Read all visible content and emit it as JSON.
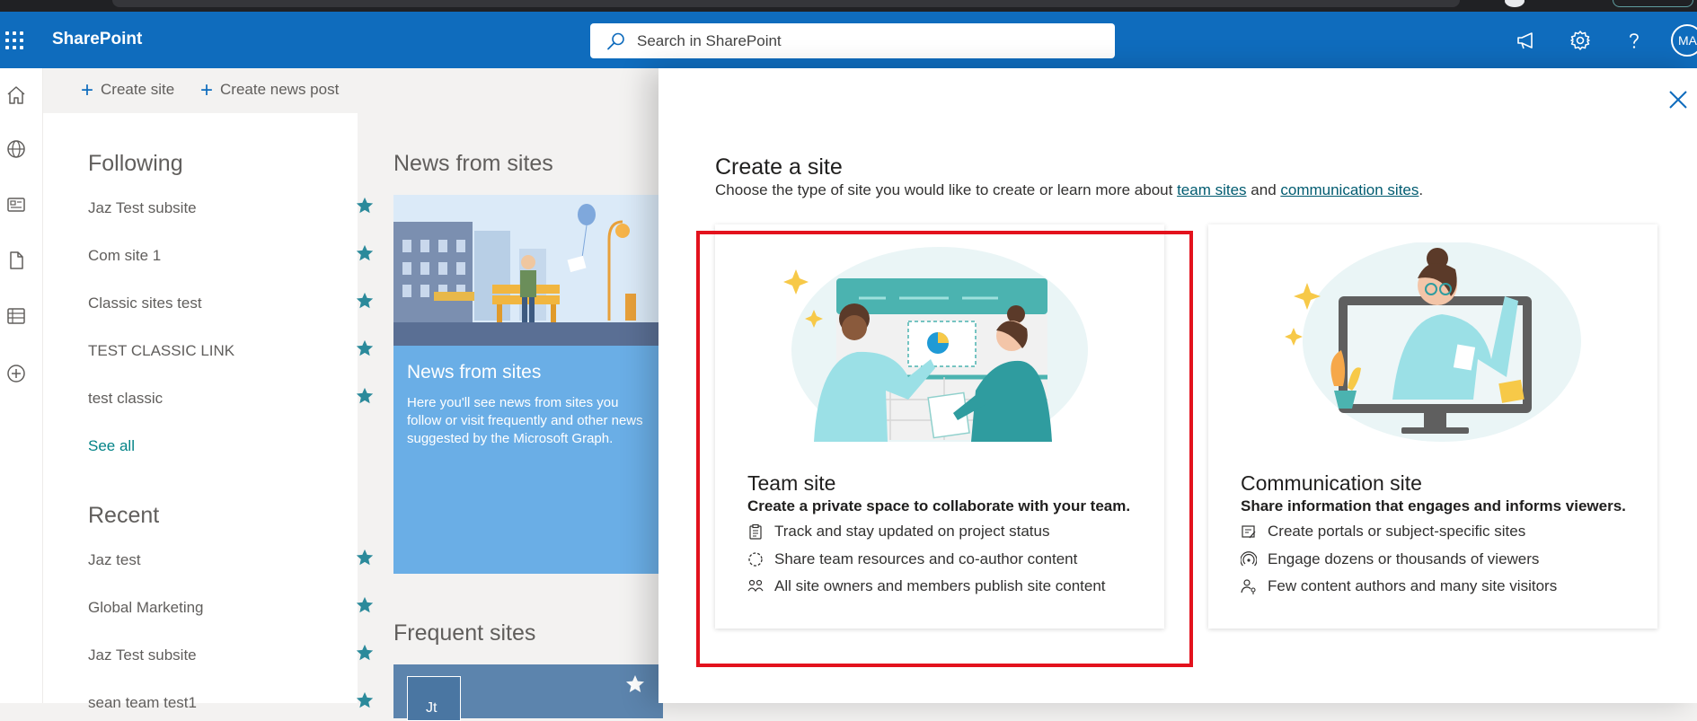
{
  "suite": {
    "app_name": "SharePoint",
    "search_placeholder": "Search in SharePoint",
    "avatar_initials": "MA"
  },
  "command_bar": {
    "create_site": "Create site",
    "create_news_post": "Create news post"
  },
  "following": {
    "heading": "Following",
    "items": [
      {
        "name": "Jaz Test subsite"
      },
      {
        "name": "Com site 1"
      },
      {
        "name": "Classic sites test"
      },
      {
        "name": "TEST CLASSIC LINK"
      },
      {
        "name": "test classic"
      }
    ],
    "see_all": "See all"
  },
  "recent": {
    "heading": "Recent",
    "items": [
      {
        "name": "Jaz test"
      },
      {
        "name": "Global Marketing"
      },
      {
        "name": "Jaz Test subsite"
      },
      {
        "name": "sean team test1"
      }
    ]
  },
  "news": {
    "heading": "News from sites",
    "card_title": "News from sites",
    "card_description": "Here you'll see news from sites you follow or visit frequently and other news suggested by the Microsoft Graph."
  },
  "frequent": {
    "heading": "Frequent sites",
    "tile_initial": "Jt"
  },
  "create_panel": {
    "title": "Create a site",
    "subtitle_before": "Choose the type of site you would like to create or learn more about ",
    "link_team_sites": "team sites",
    "subtitle_mid": " and ",
    "link_communication_sites": "communication sites",
    "subtitle_after": ".",
    "team_site": {
      "title": "Team site",
      "subtitle": "Create a private space to collaborate with your team.",
      "features": [
        "Track and stay updated on project status",
        "Share team resources and co-author content",
        "All site owners and members publish site content"
      ]
    },
    "communication_site": {
      "title": "Communication site",
      "subtitle": "Share information that engages and informs viewers.",
      "features": [
        "Create portals or subject-specific sites",
        "Engage dozens or thousands of viewers",
        "Few content authors and many site visitors"
      ]
    }
  },
  "colors": {
    "suite_bar": "#0f6cbd",
    "accent_teal": "#038387",
    "highlight_red": "#e3121d",
    "star": "#2b8a9b"
  }
}
